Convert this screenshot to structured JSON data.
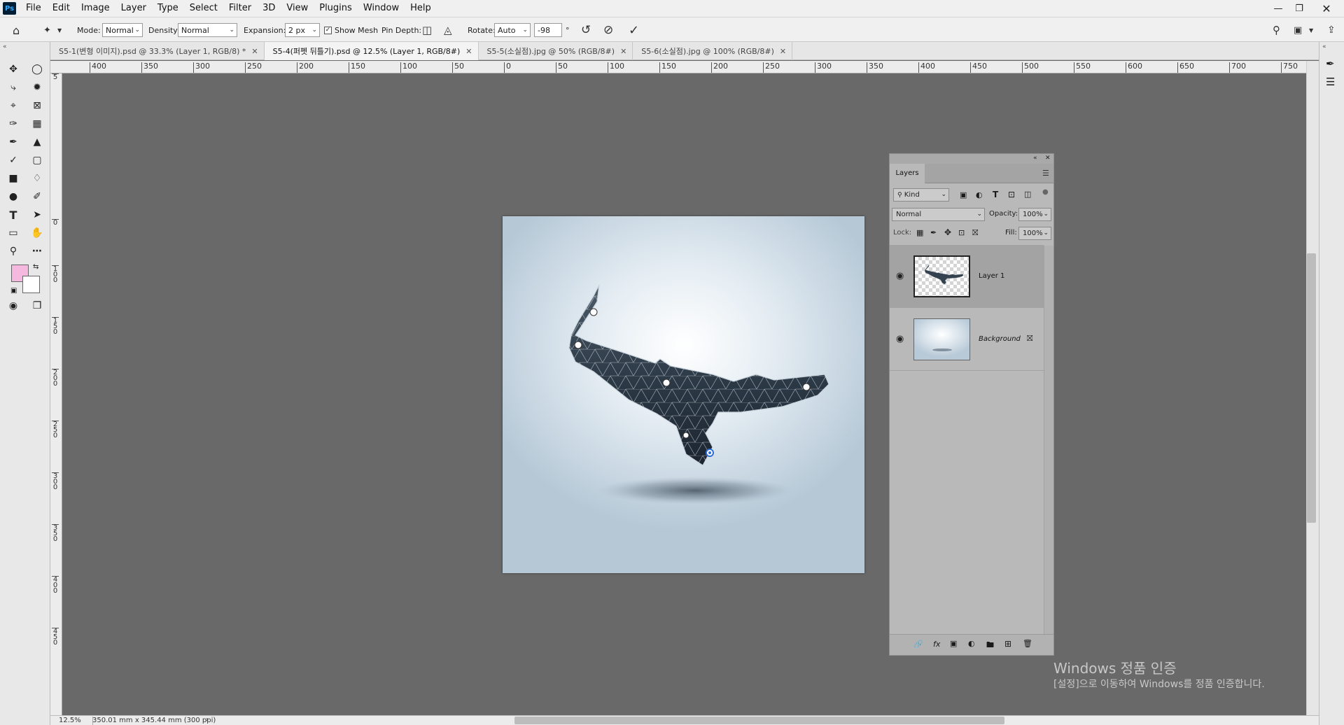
{
  "menubar": {
    "logo": "Ps",
    "items": [
      "File",
      "Edit",
      "Image",
      "Layer",
      "Type",
      "Select",
      "Filter",
      "3D",
      "View",
      "Plugins",
      "Window",
      "Help"
    ]
  },
  "options": {
    "mode_label": "Mode:",
    "mode_value": "Normal",
    "density_label": "Density:",
    "density_value": "Normal",
    "expansion_label": "Expansion:",
    "expansion_value": "2 px",
    "show_mesh_label": "Show Mesh",
    "pin_depth_label": "Pin Depth:",
    "rotate_label": "Rotate:",
    "rotate_value": "Auto",
    "rotate_angle": "-98",
    "degree": "°"
  },
  "tabs": [
    {
      "label": "S5-1(변형 이미지).psd @ 33.3% (Layer 1, RGB/8) *"
    },
    {
      "label": "S5-4(퍼펫 뒤틀기).psd @ 12.5% (Layer 1, RGB/8#)"
    },
    {
      "label": "S5-5(소실점).jpg @ 50% (RGB/8#)"
    },
    {
      "label": "S5-6(소실점).jpg @ 100% (RGB/8#)"
    }
  ],
  "ruler": {
    "h": [
      "400",
      "350",
      "300",
      "250",
      "200",
      "150",
      "100",
      "50",
      "0",
      "50",
      "100",
      "150",
      "200",
      "250",
      "300",
      "350",
      "400",
      "450",
      "500",
      "550",
      "600",
      "650",
      "700",
      "750"
    ],
    "v": [
      "5",
      "0",
      "1 0 0",
      "1 5 0",
      "2 0 0",
      "2 5 0",
      "3 0 0",
      "3 5 0",
      "4 0 0",
      "4 5 0"
    ]
  },
  "layers_panel": {
    "tab": "Layers",
    "filter_kind": "Kind",
    "blend_mode": "Normal",
    "opacity_label": "Opacity:",
    "opacity_value": "100%",
    "lock_label": "Lock:",
    "fill_label": "Fill:",
    "fill_value": "100%",
    "layers": [
      {
        "name": "Layer 1"
      },
      {
        "name": "Background"
      }
    ]
  },
  "status": {
    "zoom": "12.5%",
    "doc_info": "350.01 mm x 345.44 mm (300 ppi)",
    "arrow": "›"
  },
  "watermark": {
    "line1": "Windows 정품 인증",
    "line2": "[설정]으로 이동하여 Windows를 정품 인증합니다."
  },
  "colors": {
    "foreground": "#f5b8df",
    "background": "#ffffff"
  }
}
